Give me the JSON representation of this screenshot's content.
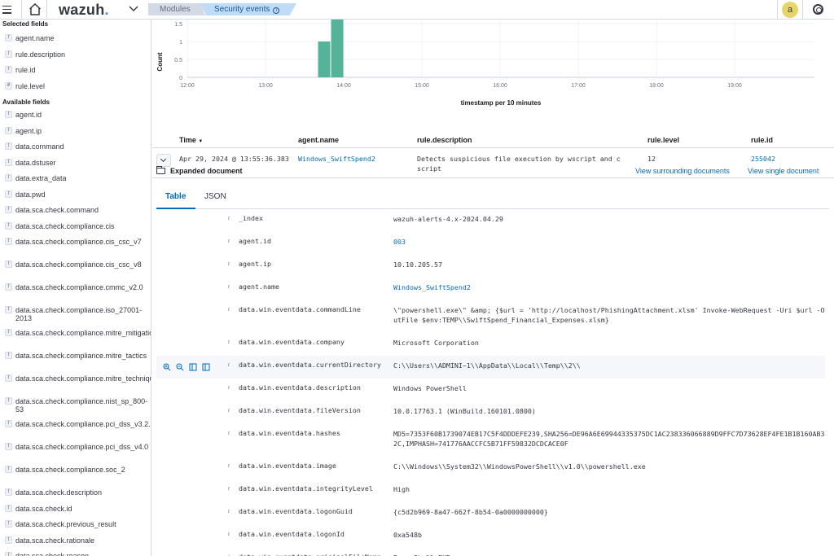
{
  "header": {
    "logo": "wazuh",
    "logo_dot": ".",
    "crumbs": [
      "Modules",
      "Security events"
    ],
    "avatar": "a"
  },
  "sidebar": {
    "selected_title": "Selected fields",
    "selected": [
      {
        "type": "t",
        "name": "agent.name"
      },
      {
        "type": "t",
        "name": "rule.description"
      },
      {
        "type": "t",
        "name": "rule.id"
      },
      {
        "type": "#",
        "name": "rule.level"
      }
    ],
    "available_title": "Available fields",
    "available": [
      {
        "type": "t",
        "name": "agent.id"
      },
      {
        "type": "t",
        "name": "agent.ip"
      },
      {
        "type": "t",
        "name": "data.command"
      },
      {
        "type": "t",
        "name": "data.dstuser"
      },
      {
        "type": "t",
        "name": "data.extra_data"
      },
      {
        "type": "t",
        "name": "data.pwd"
      },
      {
        "type": "t",
        "name": "data.sca.check.command"
      },
      {
        "type": "t",
        "name": "data.sca.check.compliance.cis"
      },
      {
        "type": "t",
        "name": "data.sca.check.compliance.cis_csc_v7"
      },
      {
        "type": "t",
        "name": "data.sca.check.compliance.cis_csc_v8"
      },
      {
        "type": "t",
        "name": "data.sca.check.compliance.cmmc_v2.0"
      },
      {
        "type": "t",
        "name": "data.sca.check.compliance.iso_27001-2013"
      },
      {
        "type": "t",
        "name": "data.sca.check.compliance.mitre_mitigations"
      },
      {
        "type": "t",
        "name": "data.sca.check.compliance.mitre_tactics"
      },
      {
        "type": "t",
        "name": "data.sca.check.compliance.mitre_techniques"
      },
      {
        "type": "t",
        "name": "data.sca.check.compliance.nist_sp_800-53"
      },
      {
        "type": "t",
        "name": "data.sca.check.compliance.pci_dss_v3.2.1"
      },
      {
        "type": "t",
        "name": "data.sca.check.compliance.pci_dss_v4.0"
      },
      {
        "type": "t",
        "name": "data.sca.check.compliance.soc_2"
      },
      {
        "type": "t",
        "name": "data.sca.check.description"
      },
      {
        "type": "t",
        "name": "data.sca.check.id"
      },
      {
        "type": "t",
        "name": "data.sca.check.previous_result"
      },
      {
        "type": "t",
        "name": "data.sca.check.rationale"
      },
      {
        "type": "t",
        "name": "data.sca.check.reason"
      }
    ]
  },
  "chart_data": {
    "type": "bar",
    "xlabel": "timestamp per 10 minutes",
    "ylabel": "Count",
    "y_ticks": [
      "0",
      "0.5",
      "1",
      "1.5"
    ],
    "ylim": [
      0,
      1.5
    ],
    "x_ticks": [
      "12:00",
      "13:00",
      "14:00",
      "15:00",
      "16:00",
      "17:00",
      "18:00",
      "19:00"
    ],
    "x": [
      "13:40",
      "13:50"
    ],
    "values": [
      1,
      2
    ],
    "bar_color": "#54b399"
  },
  "table": {
    "headers": {
      "time": "Time",
      "agent": "agent.name",
      "desc": "rule.description",
      "level": "rule.level",
      "id": "rule.id"
    },
    "row": {
      "time": "Apr 29, 2024 @ 13:55:36.383",
      "agent": "Windows_SwiftSpend2",
      "desc": "Detects suspicious file execution by wscript and cscript",
      "level": "12",
      "id": "255042"
    }
  },
  "expanded": {
    "title": "Expanded document",
    "surrounding": "View surrounding documents",
    "single": "View single document",
    "tabs": [
      "Table",
      "JSON"
    ]
  },
  "document": [
    {
      "type": "t",
      "key": "_index",
      "value": "wazuh-alerts-4.x-2024.04.29",
      "link": false
    },
    {
      "type": "t",
      "key": "agent.id",
      "value": "003",
      "link": true
    },
    {
      "type": "t",
      "key": "agent.ip",
      "value": "10.10.205.57",
      "link": false
    },
    {
      "type": "t",
      "key": "agent.name",
      "value": "Windows_SwiftSpend2",
      "link": true
    },
    {
      "type": "t",
      "key": "data.win.eventdata.commandLine",
      "value": "\\\"powershell.exe\\\" &amp; {$url = 'http://localhost/PhishingAttachment.xlsm' Invoke-WebRequest -Uri $url -OutFile $env:TEMP\\\\SwiftSpend_Financial_Expenses.xlsm}",
      "link": false
    },
    {
      "type": "t",
      "key": "data.win.eventdata.company",
      "value": "Microsoft Corporation",
      "link": false
    },
    {
      "type": "t",
      "key": "data.win.eventdata.currentDirectory",
      "value": "C:\\\\Users\\\\ADMINI~1\\\\AppData\\\\Local\\\\Temp\\\\2\\\\",
      "link": false
    },
    {
      "type": "t",
      "key": "data.win.eventdata.description",
      "value": "Windows PowerShell",
      "link": false
    },
    {
      "type": "t",
      "key": "data.win.eventdata.fileVersion",
      "value": "10.0.17763.1 (WinBuild.160101.0800)",
      "link": false
    },
    {
      "type": "t",
      "key": "data.win.eventdata.hashes",
      "value": "MD5=7353F60B1739074EB17C5F4DDDEFE239,SHA256=DE96A6E69944335375DC1AC238336066889D9FFC7D73628EF4FE1B1B160AB32C,IMPHASH=741776AACCFC5B71FF59832DCDCACE0F",
      "link": false
    },
    {
      "type": "t",
      "key": "data.win.eventdata.image",
      "value": "C:\\\\Windows\\\\System32\\\\WindowsPowerShell\\\\v1.0\\\\powershell.exe",
      "link": false
    },
    {
      "type": "t",
      "key": "data.win.eventdata.integrityLevel",
      "value": "High",
      "link": false
    },
    {
      "type": "t",
      "key": "data.win.eventdata.logonGuid",
      "value": "{c5d2b969-8a47-662f-8b54-0a0000000000}",
      "link": false
    },
    {
      "type": "t",
      "key": "data.win.eventdata.logonId",
      "value": "0xa548b",
      "link": false
    },
    {
      "type": "t",
      "key": "data.win.eventdata.originalFileName",
      "value": "PowerShell.EXE",
      "link": false
    }
  ]
}
